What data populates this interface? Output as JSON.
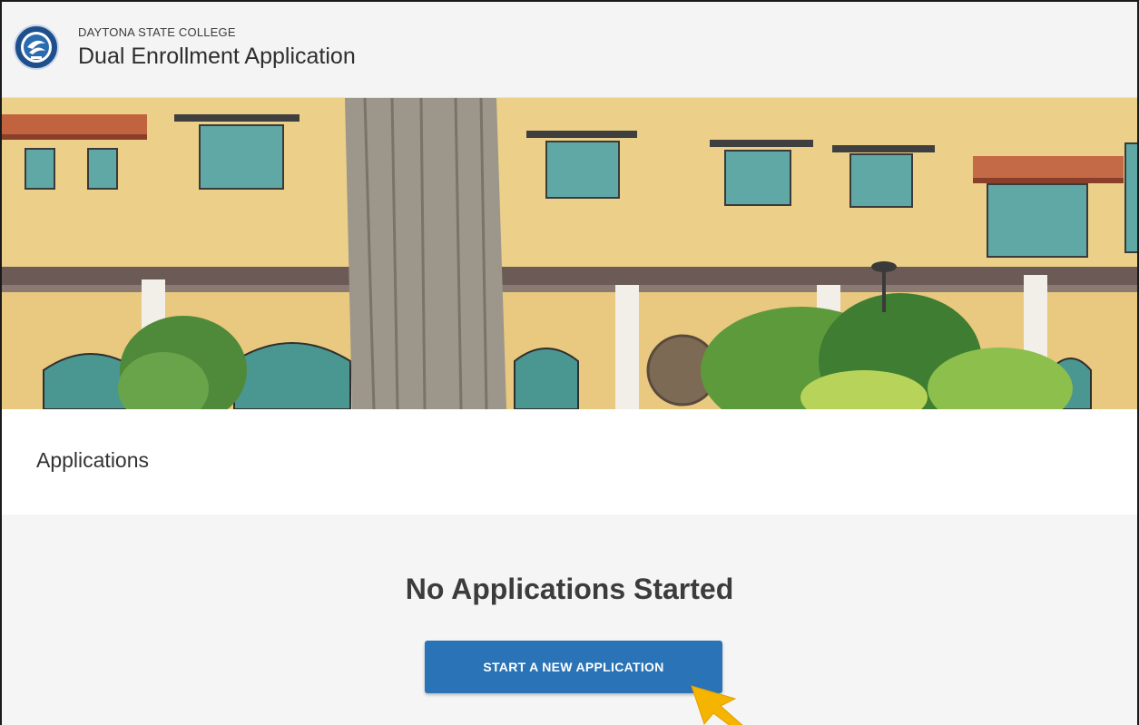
{
  "header": {
    "college_name": "DAYTONA STATE COLLEGE",
    "app_title": "Dual Enrollment Application",
    "logo_icon": "college-seal-icon"
  },
  "hero": {
    "image": "campus-building-photo"
  },
  "main": {
    "section_title": "Applications",
    "empty_state_title": "No Applications Started",
    "start_button_label": "START A NEW APPLICATION"
  },
  "overlay": {
    "cursor_icon": "pointer-arrow-icon"
  },
  "colors": {
    "header_bg": "#f4f4f4",
    "panel_bg": "#f5f5f5",
    "button_bg": "#2a73b6",
    "cursor": "#f5b400"
  }
}
